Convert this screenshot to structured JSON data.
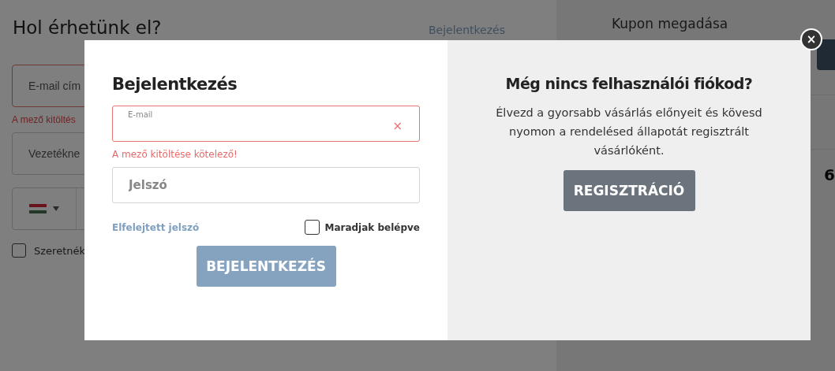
{
  "page": {
    "heading": "Hol érhetünk el?",
    "login_link": "Bejelentkezés",
    "email_field": {
      "placeholder": "E-mail cím",
      "error": true
    },
    "error_message": "A mező kitöltés",
    "surname_field": {
      "placeholder": "Vezetékne"
    },
    "newsletter": {
      "label": "Szeretnék",
      "checked": false
    }
  },
  "sidebar": {
    "coupon_title": "Kupon megadása",
    "total": "6"
  },
  "modal": {
    "close": "×",
    "login": {
      "title": "Bejelentkezés",
      "email": {
        "label": "E-mail",
        "error": true,
        "clear": "×"
      },
      "error_message": "A mező kitöltése kötelező!",
      "password": {
        "placeholder": "Jelszó"
      },
      "forgot_link": "Elfelejtett jelszó",
      "remember": {
        "label": "Maradjak belépve",
        "checked": false
      },
      "submit": "BEJELENTKEZÉS"
    },
    "register": {
      "title": "Még nincs felhasználói fiókod?",
      "text": "Élvezd a gyorsabb vásárlás előnyeit és kövesd nyomon a rendelésed állapotát regisztrált vásárlóként.",
      "button": "REGISZTRÁCIÓ"
    }
  }
}
